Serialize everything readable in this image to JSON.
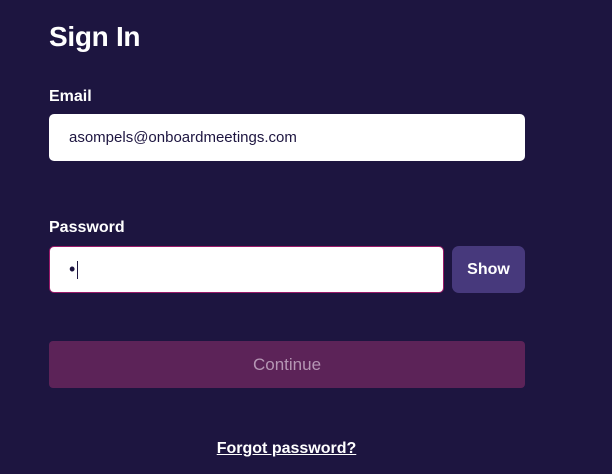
{
  "signin": {
    "title": "Sign In",
    "email": {
      "label": "Email",
      "value": "asompels@onboardmeetings.com"
    },
    "password": {
      "label": "Password",
      "value": "•",
      "show_label": "Show"
    },
    "continue_label": "Continue",
    "forgot_label": "Forgot password?"
  },
  "colors": {
    "background": "#1d1540",
    "show_button": "#47397c",
    "continue_button": "#5c2358",
    "continue_text": "#b596b4",
    "password_focus_border": "#9a1a6a"
  }
}
